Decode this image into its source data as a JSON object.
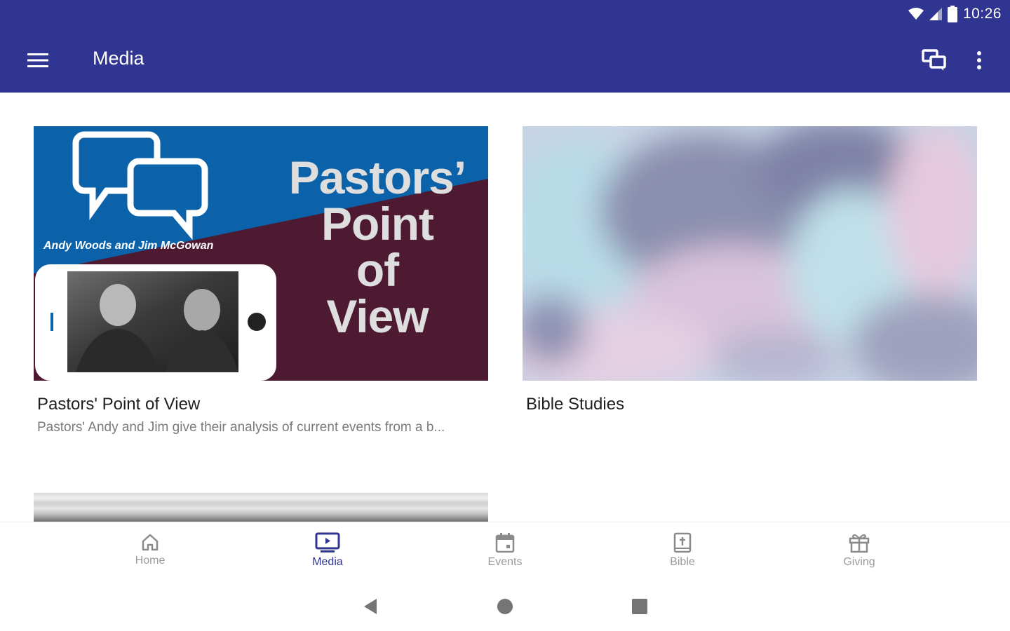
{
  "status_bar": {
    "time": "10:26"
  },
  "app_bar": {
    "title": "Media"
  },
  "cards": [
    {
      "title": "Pastors' Point of View",
      "description": "Pastors' Andy and Jim give their analysis of current events from a b...",
      "thumbnail": {
        "headline_line1": "Pastors’",
        "headline_line2": "Point",
        "headline_line3": "of",
        "headline_line4": "View",
        "byline": "Andy Woods and Jim McGowan"
      }
    },
    {
      "title": "Bible Studies"
    }
  ],
  "bottom_nav": {
    "items": [
      {
        "label": "Home",
        "icon": "home-icon"
      },
      {
        "label": "Media",
        "icon": "media-icon",
        "active": true
      },
      {
        "label": "Events",
        "icon": "calendar-icon"
      },
      {
        "label": "Bible",
        "icon": "bible-icon"
      },
      {
        "label": "Giving",
        "icon": "gift-icon"
      }
    ]
  },
  "colors": {
    "primary": "#303591",
    "thumb_blue": "#0b62a8",
    "thumb_maroon": "#4d1a32"
  }
}
